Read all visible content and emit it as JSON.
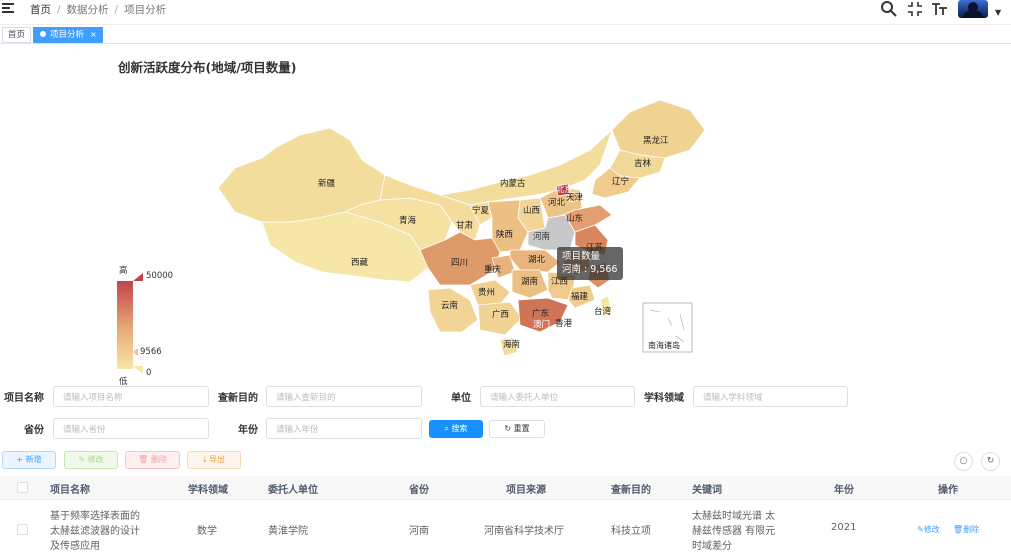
{
  "header": {
    "breadcrumb": [
      "首页",
      "数据分析",
      "项目分析"
    ],
    "separator": "/"
  },
  "tags": {
    "home": "首页",
    "active": "项目分析",
    "close": "×"
  },
  "chart_data": {
    "type": "map",
    "title": "创新活跃度分布(地域/项目数量)",
    "visual_map": {
      "high_label": "高",
      "low_label": "低",
      "max": 50000,
      "min": 0,
      "pointer_value": 9566
    },
    "tooltip": {
      "title": "项目数量",
      "province": "河南",
      "value": "9,566"
    },
    "regions": [
      {
        "name": "黑龙江"
      },
      {
        "name": "吉林"
      },
      {
        "name": "辽宁"
      },
      {
        "name": "内蒙古"
      },
      {
        "name": "北京"
      },
      {
        "name": "天津"
      },
      {
        "name": "河北"
      },
      {
        "name": "新疆"
      },
      {
        "name": "宁夏"
      },
      {
        "name": "山西"
      },
      {
        "name": "山东"
      },
      {
        "name": "青海"
      },
      {
        "name": "甘肃"
      },
      {
        "name": "陕西"
      },
      {
        "name": "河南"
      },
      {
        "name": "江苏"
      },
      {
        "name": "西藏"
      },
      {
        "name": "四川"
      },
      {
        "name": "湖北"
      },
      {
        "name": "重庆"
      },
      {
        "name": "湖南"
      },
      {
        "name": "江西"
      },
      {
        "name": "贵州"
      },
      {
        "name": "福建"
      },
      {
        "name": "台湾"
      },
      {
        "name": "云南"
      },
      {
        "name": "广西"
      },
      {
        "name": "广东"
      },
      {
        "name": "澳门"
      },
      {
        "name": "香港"
      },
      {
        "name": "海南"
      },
      {
        "name": "南海诸岛"
      }
    ]
  },
  "search": {
    "name_label": "项目名称",
    "name_placeholder": "请输入项目名称",
    "purpose_label": "查新目的",
    "purpose_placeholder": "请输入查新目的",
    "unit_label": "单位",
    "unit_placeholder": "请输入委托人单位",
    "field_label": "学科领域",
    "field_placeholder": "请输入学科领域",
    "province_label": "省份",
    "province_placeholder": "请输入省份",
    "year_label": "年份",
    "year_placeholder": "请输入年份",
    "search_btn": "搜索",
    "reset_btn": "重置"
  },
  "toolbar": {
    "add": "新增",
    "edit": "修改",
    "delete": "删除",
    "export": "导出"
  },
  "table": {
    "columns": [
      "项目名称",
      "学科领域",
      "委托人单位",
      "省份",
      "项目来源",
      "查新目的",
      "关键词",
      "年份",
      "操作"
    ],
    "rows": [
      {
        "name": [
          "基于频率选择表面的",
          "太赫兹滤波器的设计",
          "及传感应用"
        ],
        "field": "数学",
        "unit": "黄淮学院",
        "province": "河南",
        "source": "河南省科学技术厅",
        "purpose": "科技立项",
        "keywords": [
          "太赫兹时域光谱 太",
          "赫兹传感器 有限元",
          "时域差分"
        ],
        "year": "2021",
        "edit": "修改",
        "delete": "删除"
      }
    ]
  },
  "colors": {
    "primary": "#1890ff",
    "high": "#c0454a",
    "low": "#f6e6a8"
  }
}
